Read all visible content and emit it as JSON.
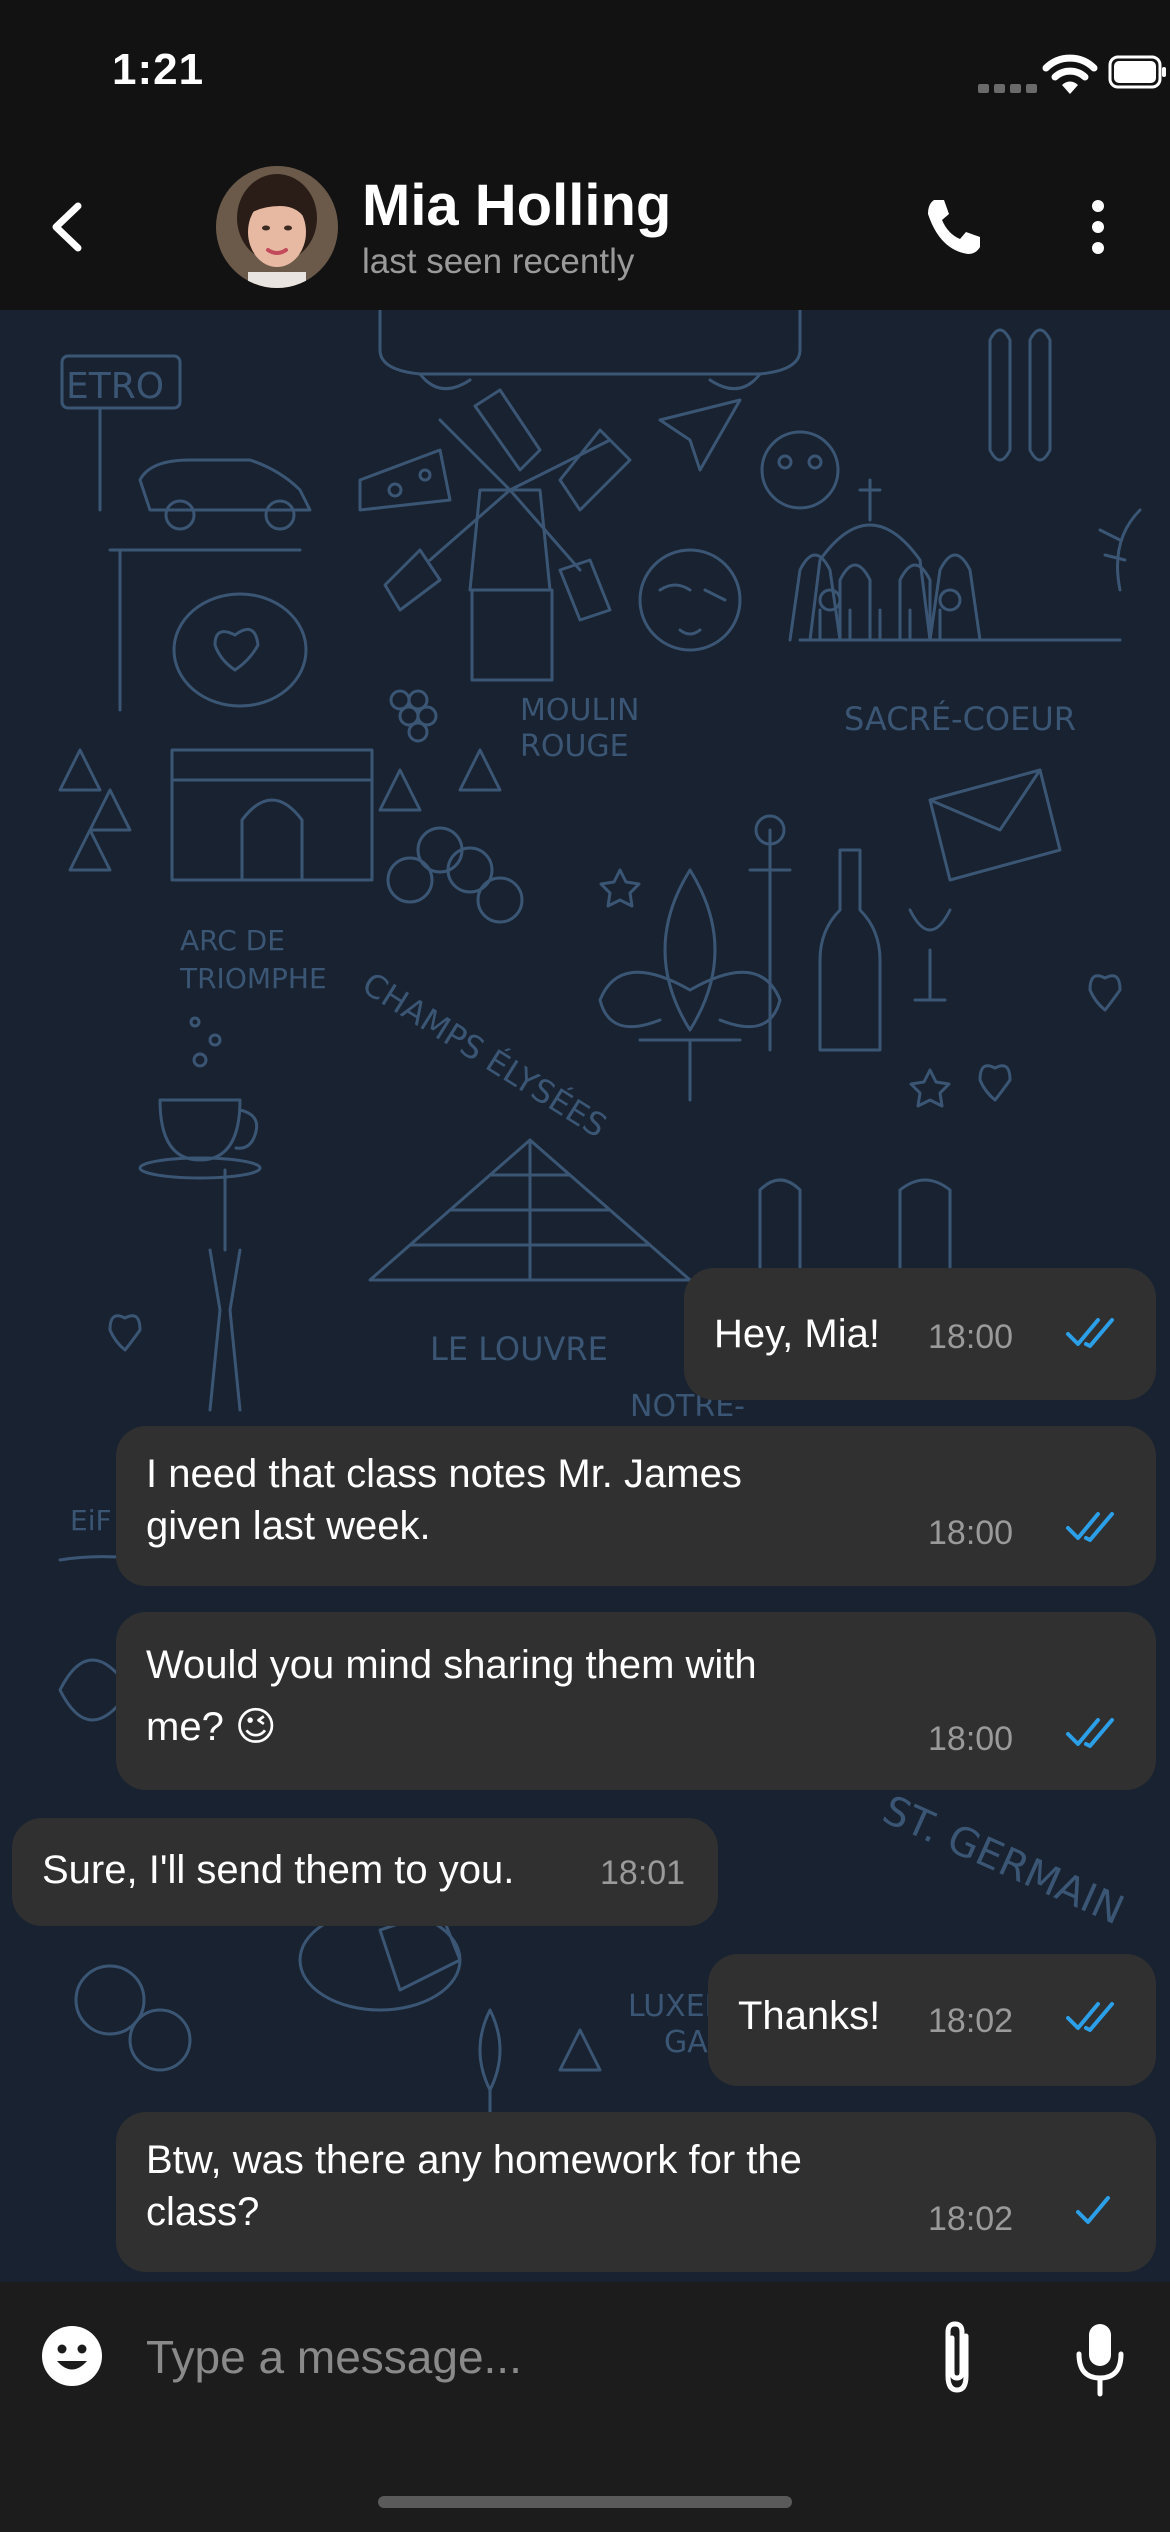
{
  "status_bar": {
    "time": "1:21"
  },
  "header": {
    "contact_name": "Mia Holling",
    "status": "last seen recently"
  },
  "wallpaper_labels": {
    "metro": "ETRO",
    "moulin": "MOULIN",
    "rouge": "ROUGE",
    "sacre": "SACRÉ-COEUR",
    "arc1": "ARC DE",
    "arc2": "TRIOMPHE",
    "champs": "CHAMPS ÉLYSÉES",
    "louvre": "LE LOUVRE",
    "notre": "NOTRE-",
    "eif": "EiF",
    "stg": "ST. GERMAIN",
    "lux": "LUXEN",
    "ga": "GA"
  },
  "messages": [
    {
      "text": "Hey, Mia!",
      "time": "18:00",
      "direction": "outgoing",
      "status": "read"
    },
    {
      "text": "I need that class notes Mr. James\ngiven last week.",
      "time": "18:00",
      "direction": "outgoing",
      "status": "read"
    },
    {
      "text": "Would you mind sharing them with\nme? 😉",
      "time": "18:00",
      "direction": "outgoing",
      "status": "read"
    },
    {
      "text": "Sure, I'll send them to you.",
      "time": "18:01",
      "direction": "incoming",
      "status": ""
    },
    {
      "text": "Thanks!",
      "time": "18:02",
      "direction": "outgoing",
      "status": "read"
    },
    {
      "text": "Btw, was there any homework for the\nclass?",
      "time": "18:02",
      "direction": "outgoing",
      "status": "sent"
    }
  ],
  "input": {
    "placeholder": "Type a message..."
  },
  "colors": {
    "background": "#121212",
    "chat_background": "#182230",
    "wallpaper_line": "#3b5674",
    "bubble": "#303030",
    "tick": "#2b9fe8",
    "secondary_text": "#9a9a9a"
  },
  "icons": [
    "back-arrow-icon",
    "phone-icon",
    "more-vertical-icon",
    "emoji-icon",
    "paperclip-icon",
    "microphone-icon",
    "double-check-icon",
    "single-check-icon",
    "wifi-icon",
    "battery-icon"
  ]
}
